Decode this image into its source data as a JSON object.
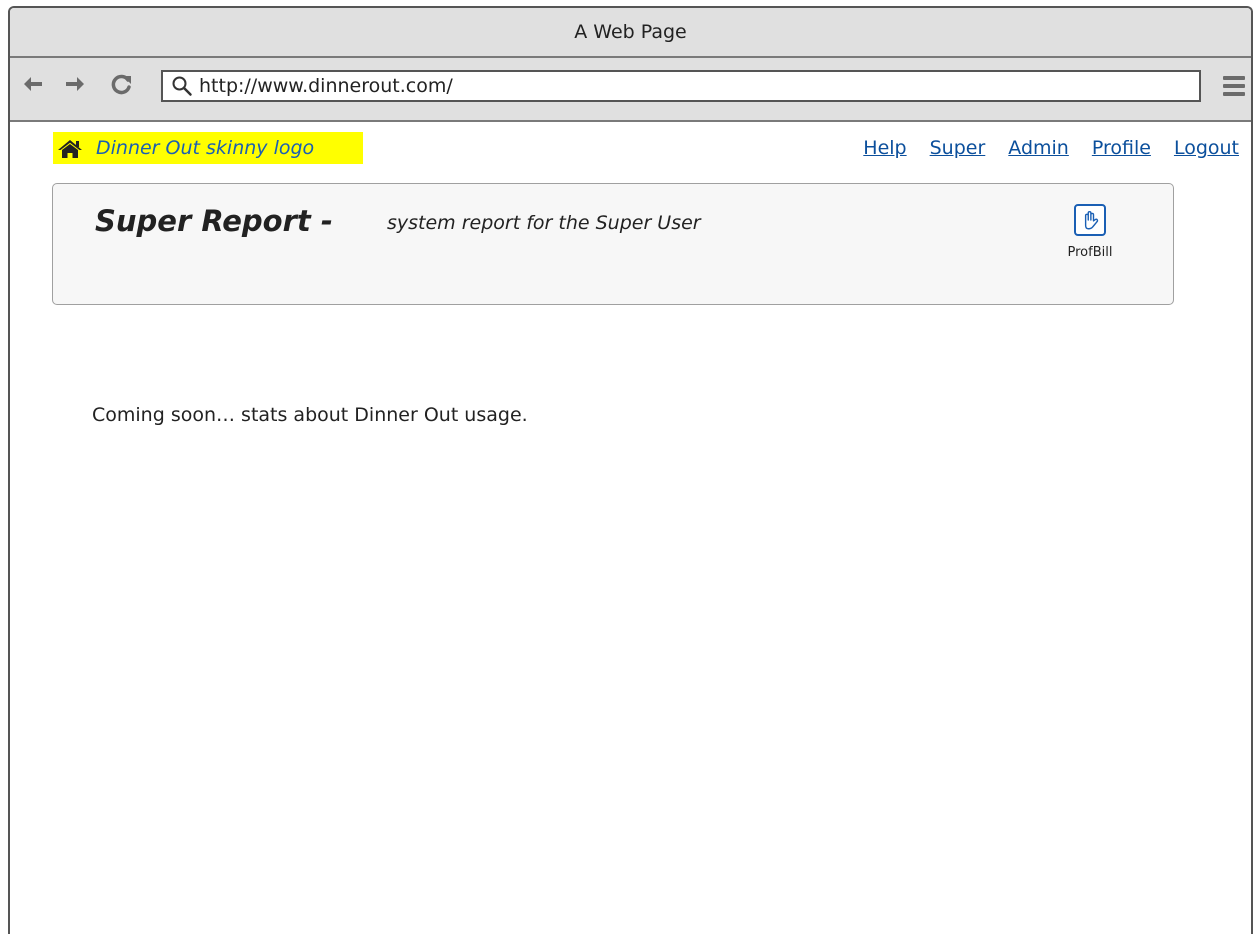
{
  "window": {
    "title": "A Web Page"
  },
  "toolbar": {
    "back_icon": "arrow-left-icon",
    "forward_icon": "arrow-right-icon",
    "reload_icon": "reload-icon",
    "url": "http://www.dinnerout.com/",
    "menu_icon": "hamburger-menu-icon"
  },
  "header": {
    "logo_text": "Dinner Out skinny logo",
    "logo_icon": "home-icon",
    "logo_color": "#ffff00",
    "links": {
      "help": "Help",
      "super": "Super",
      "admin": "Admin",
      "profile": "Profile",
      "logout": "Logout"
    },
    "link_color": "#0b4f9c"
  },
  "panel": {
    "title": "Super Report -",
    "subtitle": "system report for the Super User",
    "action_icon": "hand-icon",
    "action_label": "ProfBill"
  },
  "main": {
    "message": "Coming soon… stats about Dinner Out usage."
  }
}
